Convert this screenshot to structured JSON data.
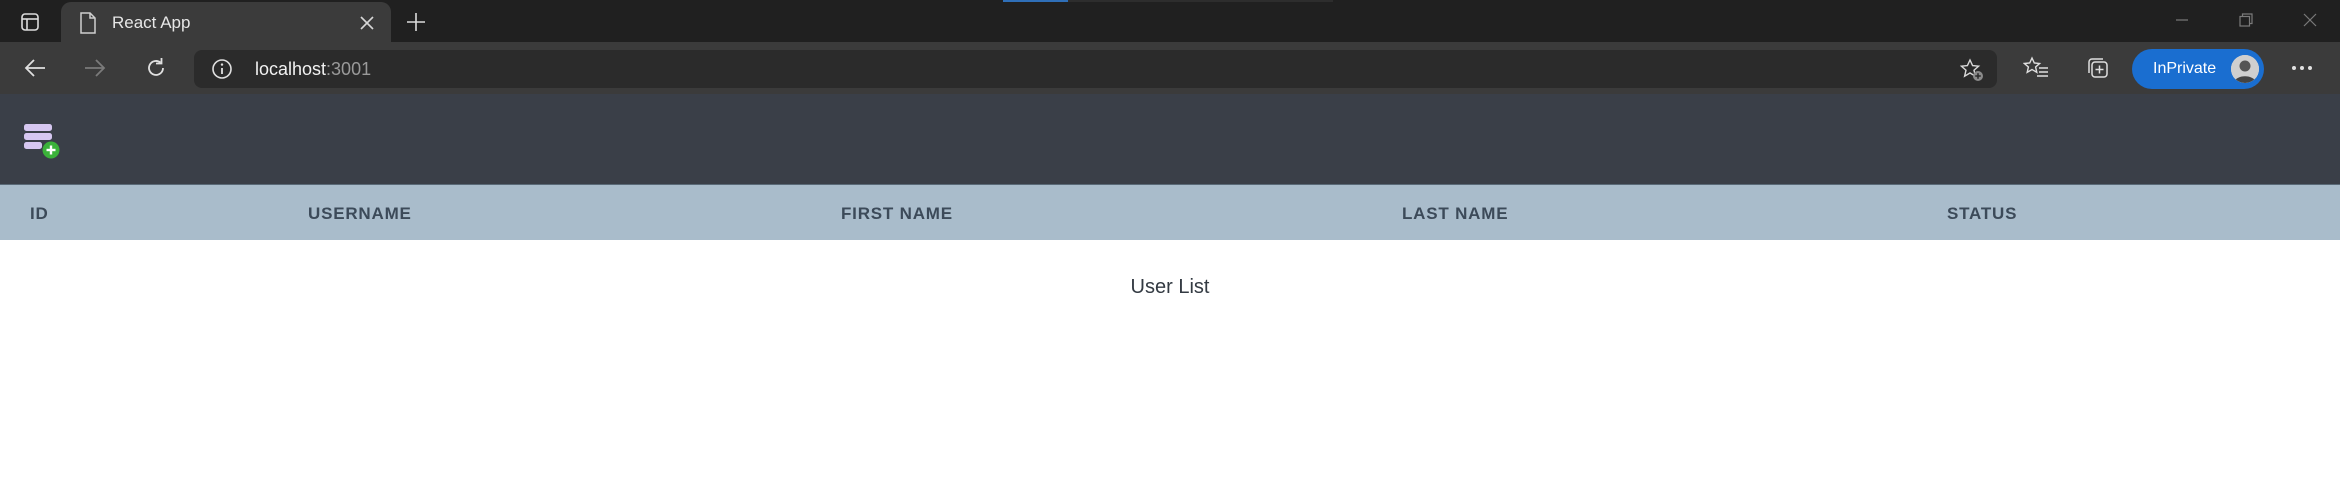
{
  "browser": {
    "tab": {
      "title": "React App"
    },
    "address": {
      "host": "localhost",
      "port": ":3001"
    },
    "inprivate_label": "InPrivate"
  },
  "app": {
    "table": {
      "columns": [
        "ID",
        "USERNAME",
        "FIRST NAME",
        "LAST NAME",
        "STATUS"
      ]
    },
    "caption": "User List"
  },
  "colors": {
    "header_bg": "#3a3f48",
    "table_header_bg": "#a9bccb",
    "accent": "#1a6ed0"
  },
  "icons": [
    "tab-actions-icon",
    "page-icon",
    "close-icon",
    "plus-icon",
    "back-icon",
    "forward-icon",
    "refresh-icon",
    "info-icon",
    "add-favorite-icon",
    "favorites-icon",
    "collections-icon",
    "more-icon",
    "add-user-icon"
  ]
}
